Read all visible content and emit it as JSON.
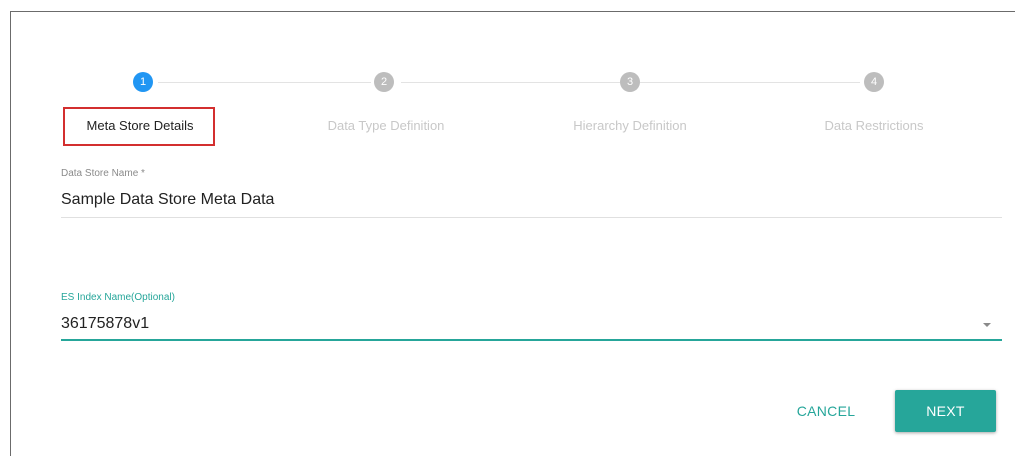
{
  "stepper": {
    "steps": [
      {
        "number": "1",
        "label": "Meta Store Details",
        "state": "active"
      },
      {
        "number": "2",
        "label": "Data Type Definition",
        "state": "inactive"
      },
      {
        "number": "3",
        "label": "Hierarchy Definition",
        "state": "inactive"
      },
      {
        "number": "4",
        "label": "Data Restrictions",
        "state": "inactive"
      }
    ]
  },
  "form": {
    "data_store_name": {
      "label": "Data Store Name *",
      "value": "Sample Data Store Meta Data"
    },
    "es_index_name": {
      "label": "ES Index Name(Optional)",
      "value": "36175878v1"
    }
  },
  "actions": {
    "cancel_label": "CANCEL",
    "next_label": "NEXT"
  },
  "colors": {
    "accent": "#26a69a",
    "active_step": "#2196f3",
    "highlight_border": "#d32f2f"
  }
}
